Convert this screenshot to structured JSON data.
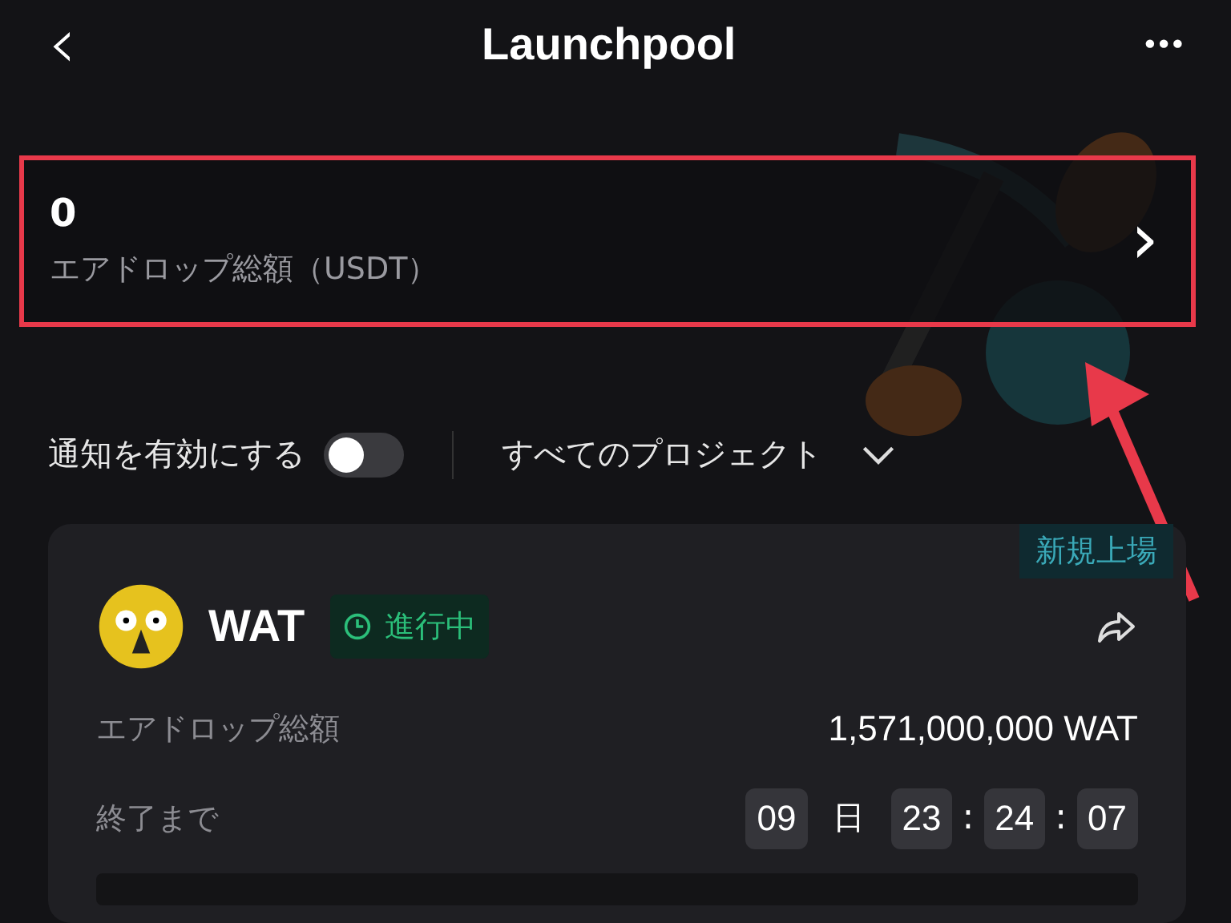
{
  "header": {
    "back": "‹",
    "title": "Launchpool",
    "more": "•••"
  },
  "summary": {
    "amount": "0",
    "label": "エアドロップ総額（USDT）",
    "chevron": "›"
  },
  "filters": {
    "notify_label": "通知を有効にする",
    "notify_on": false,
    "project_filter": "すべてのプロジェクト"
  },
  "card": {
    "badge": "新規上場",
    "token": "WAT",
    "status": "進行中",
    "rows": [
      {
        "label": "エアドロップ総額",
        "value": "1,571,000,000 WAT"
      }
    ],
    "countdown": {
      "label": "終了まで",
      "days": "09",
      "day_unit": "日",
      "hours": "23",
      "minutes": "24",
      "seconds": "07",
      "separator": ":"
    }
  }
}
